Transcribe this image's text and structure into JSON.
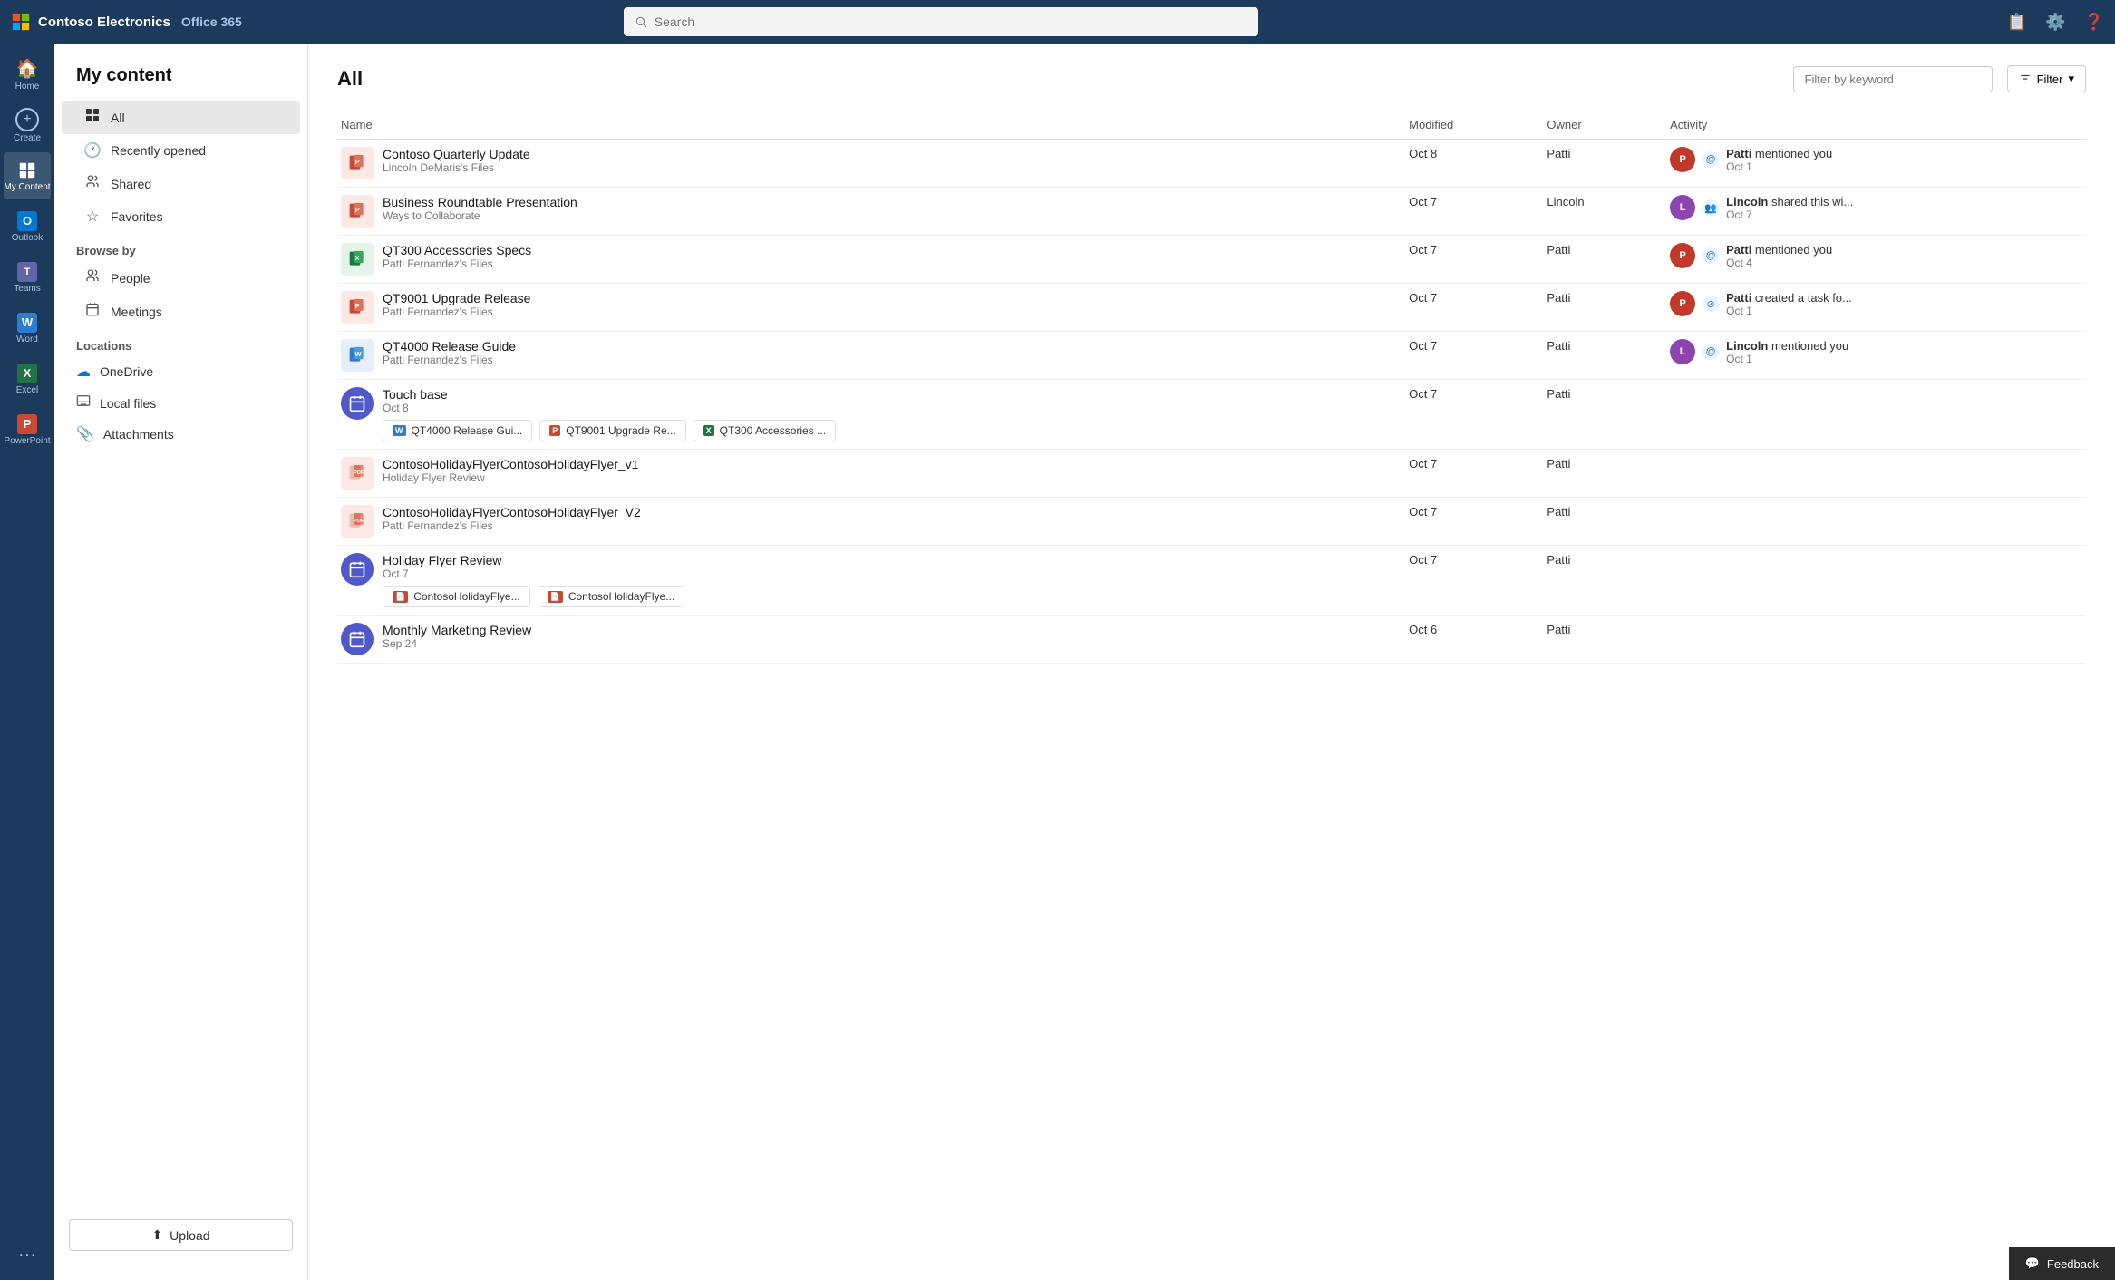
{
  "app": {
    "name": "Contoso Electronics",
    "suite": "Office 365"
  },
  "topnav": {
    "search_placeholder": "Search"
  },
  "rail": {
    "items": [
      {
        "id": "home",
        "label": "Home",
        "icon": "🏠"
      },
      {
        "id": "create",
        "label": "Create",
        "icon": "⊕"
      },
      {
        "id": "mycontent",
        "label": "My Content",
        "icon": "📁",
        "active": true
      },
      {
        "id": "outlook",
        "label": "Outlook",
        "icon": "📧"
      },
      {
        "id": "teams",
        "label": "Teams",
        "icon": "👥"
      },
      {
        "id": "word",
        "label": "Word",
        "icon": "W"
      },
      {
        "id": "excel",
        "label": "Excel",
        "icon": "X"
      },
      {
        "id": "powerpoint",
        "label": "PowerPoint",
        "icon": "P"
      }
    ],
    "more_label": "..."
  },
  "sidebar": {
    "title": "My content",
    "nav": [
      {
        "id": "all",
        "label": "All",
        "icon": "⬛",
        "active": true
      },
      {
        "id": "recently",
        "label": "Recently opened",
        "icon": "🕐"
      },
      {
        "id": "shared",
        "label": "Shared",
        "icon": "👤"
      },
      {
        "id": "favorites",
        "label": "Favorites",
        "icon": "☆"
      }
    ],
    "browse_title": "Browse by",
    "browse": [
      {
        "id": "people",
        "label": "People",
        "icon": "👥"
      },
      {
        "id": "meetings",
        "label": "Meetings",
        "icon": "📅"
      }
    ],
    "locations_title": "Locations",
    "locations": [
      {
        "id": "onedrive",
        "label": "OneDrive",
        "icon": "☁"
      },
      {
        "id": "local",
        "label": "Local files",
        "icon": "🖥"
      },
      {
        "id": "attachments",
        "label": "Attachments",
        "icon": "📎"
      }
    ],
    "upload_label": "Upload"
  },
  "content": {
    "title": "All",
    "filter_placeholder": "Filter by keyword",
    "filter_label": "Filter",
    "columns": {
      "name": "Name",
      "modified": "Modified",
      "owner": "Owner",
      "activity": "Activity"
    },
    "files": [
      {
        "id": 1,
        "icon_type": "ppt",
        "name": "Contoso Quarterly Update",
        "sub": "Lincoln DeMaris's Files",
        "modified": "Oct 8",
        "owner": "Patti",
        "activity_user": "Patti",
        "activity_text": "mentioned you",
        "activity_date": "Oct 1",
        "activity_icon": "@",
        "avatar_class": "avatar-patti",
        "avatar_initials": "P"
      },
      {
        "id": 2,
        "icon_type": "ppt",
        "name": "Business Roundtable Presentation",
        "sub": "Ways to Collaborate",
        "modified": "Oct 7",
        "owner": "Lincoln",
        "activity_user": "Lincoln",
        "activity_text": "shared this wi...",
        "activity_date": "Oct 7",
        "activity_icon": "👥",
        "avatar_class": "avatar-lincoln",
        "avatar_initials": "L"
      },
      {
        "id": 3,
        "icon_type": "xlsx",
        "name": "QT300 Accessories Specs",
        "sub": "Patti Fernandez's Files",
        "modified": "Oct 7",
        "owner": "Patti",
        "activity_user": "Patti",
        "activity_text": "mentioned you",
        "activity_date": "Oct 4",
        "activity_icon": "@",
        "avatar_class": "avatar-patti",
        "avatar_initials": "P"
      },
      {
        "id": 4,
        "icon_type": "ppt",
        "name": "QT9001 Upgrade Release",
        "sub": "Patti Fernandez's Files",
        "modified": "Oct 7",
        "owner": "Patti",
        "activity_user": "Patti",
        "activity_text": "created a task fo...",
        "activity_date": "Oct 1",
        "activity_icon": "⊘",
        "avatar_class": "avatar-patti",
        "avatar_initials": "P"
      },
      {
        "id": 5,
        "icon_type": "docx",
        "name": "QT4000 Release Guide",
        "sub": "Patti Fernandez's Files",
        "modified": "Oct 7",
        "owner": "Patti",
        "activity_user": "Lincoln",
        "activity_text": "mentioned you",
        "activity_date": "Oct 1",
        "activity_icon": "@",
        "avatar_class": "avatar-lincoln",
        "avatar_initials": "L"
      },
      {
        "id": 6,
        "icon_type": "meeting",
        "name": "Touch base",
        "sub": "Oct 8",
        "modified": "Oct 7",
        "owner": "Patti",
        "activity_user": "",
        "activity_text": "",
        "activity_date": "",
        "activity_icon": "",
        "avatar_class": "",
        "avatar_initials": "",
        "related": [
          {
            "icon_type": "docx",
            "label": "QT4000 Release Gui..."
          },
          {
            "icon_type": "ppt",
            "label": "QT9001 Upgrade Re..."
          },
          {
            "icon_type": "xlsx",
            "label": "QT300 Accessories ..."
          }
        ]
      },
      {
        "id": 7,
        "icon_type": "pdf",
        "name": "ContosoHolidayFlyerContosoHolidayFlyer_v1",
        "sub": "Holiday Flyer Review",
        "modified": "Oct 7",
        "owner": "Patti",
        "activity_user": "",
        "activity_text": "",
        "activity_date": "",
        "activity_icon": "",
        "avatar_class": "",
        "avatar_initials": ""
      },
      {
        "id": 8,
        "icon_type": "pdf",
        "name": "ContosoHolidayFlyerContosoHolidayFlyer_V2",
        "sub": "Patti Fernandez's Files",
        "modified": "Oct 7",
        "owner": "Patti",
        "activity_user": "",
        "activity_text": "",
        "activity_date": "",
        "activity_icon": "",
        "avatar_class": "",
        "avatar_initials": ""
      },
      {
        "id": 9,
        "icon_type": "meeting",
        "name": "Holiday Flyer Review",
        "sub": "Oct 7",
        "modified": "Oct 7",
        "owner": "Patti",
        "activity_user": "",
        "activity_text": "",
        "activity_date": "",
        "activity_icon": "",
        "avatar_class": "",
        "avatar_initials": "",
        "related": [
          {
            "icon_type": "pdf",
            "label": "ContosoHolidayFlye..."
          },
          {
            "icon_type": "pdf",
            "label": "ContosoHolidayFlye..."
          }
        ]
      },
      {
        "id": 10,
        "icon_type": "meeting",
        "name": "Monthly Marketing Review",
        "sub": "Sep 24",
        "modified": "Oct 6",
        "owner": "Patti",
        "activity_user": "",
        "activity_text": "",
        "activity_date": "",
        "activity_icon": "",
        "avatar_class": "",
        "avatar_initials": ""
      }
    ]
  },
  "feedback": {
    "label": "Feedback"
  }
}
